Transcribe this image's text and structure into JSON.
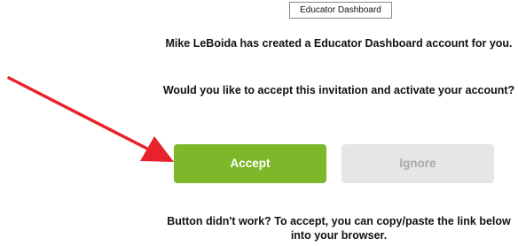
{
  "header": {
    "brand_label": "Educator Dashboard"
  },
  "invitation": {
    "created_message": "Mike LeBoida has created a Educator Dashboard account for you.",
    "question": "Would you like to accept this invitation and activate your account?"
  },
  "actions": {
    "accept_label": "Accept",
    "ignore_label": "Ignore"
  },
  "footer": {
    "fallback_text": "Button didn't work? To accept, you can copy/paste the link below into your browser."
  },
  "colors": {
    "accept_bg": "#7cb82a",
    "ignore_bg": "#e6e6e6",
    "annotation_arrow": "#e8222a"
  }
}
